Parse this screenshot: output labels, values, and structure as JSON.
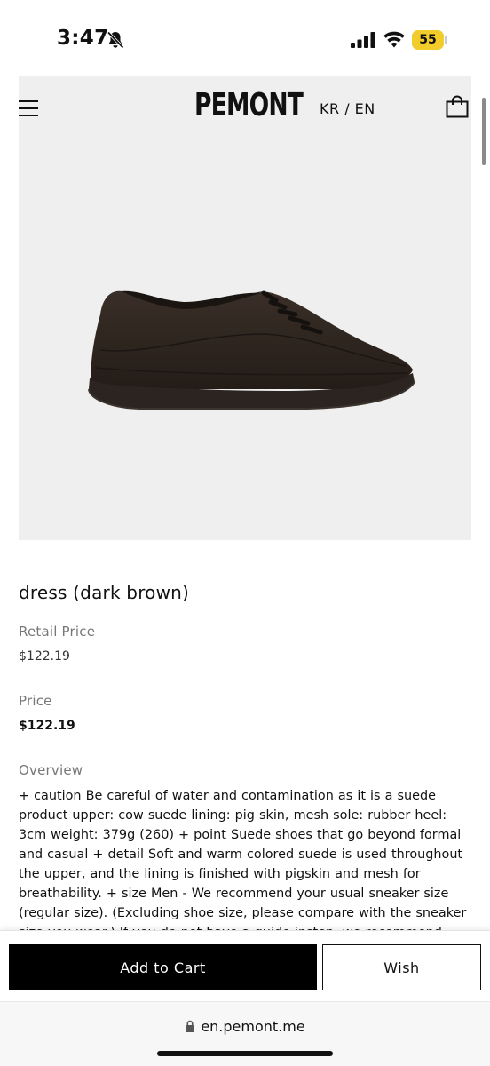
{
  "status_bar": {
    "time": "3:47",
    "battery": "55"
  },
  "header": {
    "brand": "PEMONT",
    "language": "KR / EN"
  },
  "product": {
    "title": "dress (dark brown)",
    "retail_price_label": "Retail Price",
    "retail_price": "$122.19",
    "price_label": "Price",
    "price": "$122.19",
    "overview_label": "Overview",
    "overview_text": "+ caution Be careful of water and contamination as it is a suede product upper: cow suede lining: pig skin, mesh sole: rubber heel: 3cm weight: 379g (260) + point Suede shoes that go beyond formal and casual + detail Soft and warm colored suede is used throughout the upper, and the lining is finished with pigskin and mesh for breathability. + size Men - We recommend your usual sneaker size (regular size). (Excluding shoe size, please compare with the sneaker size you wear.) If you do not have a guide insten, we recommend your"
  },
  "actions": {
    "add_to_cart": "Add to Cart",
    "wish": "Wish"
  },
  "browser": {
    "url": "en.pemont.me"
  },
  "colors": {
    "hero_background": "#efefef",
    "cart_button": "#000000",
    "battery": "#f2cc2a",
    "shoe": "#2e2520"
  },
  "icons": [
    "bell-slash-icon",
    "signal-icon",
    "wifi-icon",
    "battery-icon",
    "menu-icon",
    "shopping-bag-icon",
    "lock-icon"
  ]
}
